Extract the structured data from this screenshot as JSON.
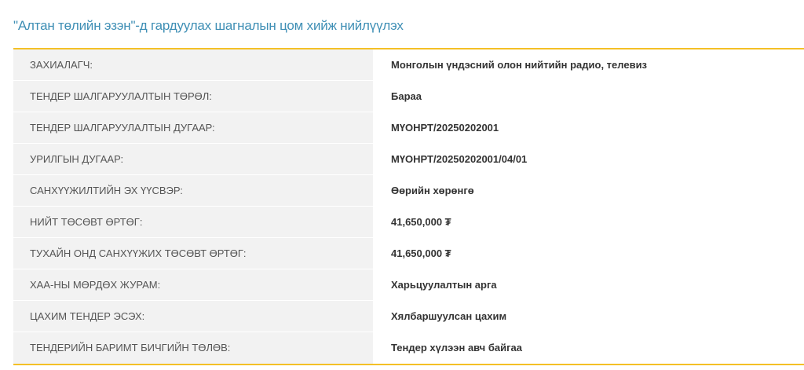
{
  "page": {
    "title": "\"Алтан төлийн эзэн\"-д гардуулах шагналын цом хийж нийлүүлэх"
  },
  "colors": {
    "title": "#3f8fb5",
    "accent_border": "#f4c026",
    "label_background": "#f2f2f2"
  },
  "tender_details": {
    "rows": [
      {
        "label": "ЗАХИАЛАГЧ:",
        "value": "Монголын үндэсний олон нийтийн радио, телевиз"
      },
      {
        "label": "ТЕНДЕР ШАЛГАРУУЛАЛТЫН ТӨРӨЛ:",
        "value": "Бараа"
      },
      {
        "label": "ТЕНДЕР ШАЛГАРУУЛАЛТЫН ДУГААР:",
        "value": "МҮОНРТ/20250202001"
      },
      {
        "label": "УРИЛГЫН ДУГААР:",
        "value": "МҮОНРТ/20250202001/04/01"
      },
      {
        "label": "САНХҮҮЖИЛТИЙН ЭХ ҮҮСВЭР:",
        "value": "Өөрийн хөрөнгө"
      },
      {
        "label": "НИЙТ ТӨСӨВТ ӨРТӨГ:",
        "value": "41,650,000 ₮"
      },
      {
        "label": "ТУХАЙН ОНД САНХҮҮЖИХ ТӨСӨВТ ӨРТӨГ:",
        "value": "41,650,000 ₮"
      },
      {
        "label": "ХАА-НЫ МӨРДӨХ ЖУРАМ:",
        "value": "Харьцуулалтын арга"
      },
      {
        "label": "ЦАХИМ ТЕНДЕР ЭСЭХ:",
        "value": "Хялбаршуулсан цахим"
      },
      {
        "label": "ТЕНДЕРИЙН БАРИМТ БИЧГИЙН ТӨЛӨВ:",
        "value": "Тендер хүлээн авч байгаа"
      }
    ]
  }
}
